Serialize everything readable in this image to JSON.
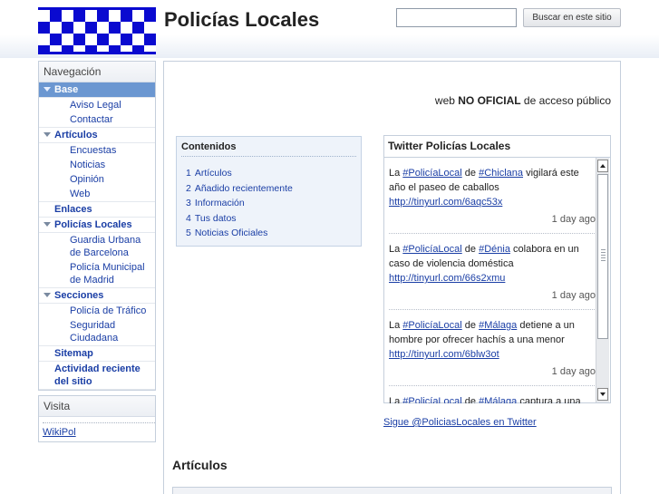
{
  "header": {
    "site_title": "Policías Locales",
    "search_placeholder": "",
    "search_button": "Buscar en este sitio"
  },
  "sidebar": {
    "nav_title": "Navegación",
    "sections": [
      {
        "label": "Base",
        "children": [
          "Aviso Legal",
          "Contactar"
        ]
      },
      {
        "label": "Artículos",
        "children": [
          "Encuestas",
          "Noticias",
          "Opinión",
          "Web"
        ]
      },
      {
        "label": "Enlaces",
        "children": []
      },
      {
        "label": "Policías Locales",
        "children": [
          "Guardia Urbana de Barcelona",
          "Policía Municipal de Madrid"
        ]
      },
      {
        "label": "Secciones",
        "children": [
          "Policía de Tráfico",
          "Seguridad Ciudadana"
        ]
      },
      {
        "label": "Sitemap",
        "children": []
      },
      {
        "label": "Actividad reciente del sitio",
        "children": []
      }
    ],
    "visit_title": "Visita",
    "visit_link": "WikiPol"
  },
  "main": {
    "tagline_prefix": "web ",
    "tagline_bold": "NO OFICIAL",
    "tagline_suffix": " de acceso público",
    "toc": {
      "title": "Contenidos",
      "items": [
        {
          "num": "1",
          "label": "Artículos"
        },
        {
          "num": "2",
          "label": "Añadido recientemente"
        },
        {
          "num": "3",
          "label": "Información"
        },
        {
          "num": "4",
          "label": "Tus datos"
        },
        {
          "num": "5",
          "label": "Noticias Oficiales"
        }
      ]
    },
    "twitter": {
      "title": "Twitter Policías Locales",
      "tweets": [
        {
          "pre": "La ",
          "tag1": "#PolicíaLocal",
          "mid": " de ",
          "tag2": "#Chiclana",
          "text": " vigilará este año el paseo de caballos",
          "url": "http://tinyurl.com/6aqc53x",
          "ago": "1 day ago"
        },
        {
          "pre": "La ",
          "tag1": "#PolicíaLocal",
          "mid": " de ",
          "tag2": "#Dénia",
          "text": " colabora en un caso de violencia doméstica",
          "url": "http://tinyurl.com/66s2xmu",
          "ago": "1 day ago"
        },
        {
          "pre": "La ",
          "tag1": "#PolicíaLocal",
          "mid": " de ",
          "tag2": "#Málaga",
          "text": " detiene a un hombre por ofrecer hachís a una menor",
          "url": "http://tinyurl.com/6blw3ot",
          "ago": "1 day ago"
        },
        {
          "pre": "La ",
          "tag1": "#PolicíaLocal",
          "mid": " de ",
          "tag2": "#Málaga",
          "text": " captura a una culebra bastarda de un metro y medio",
          "url": "",
          "ago": ""
        }
      ],
      "follow_link": "Sigue @PoliciasLocales en Twitter"
    },
    "articles_heading": "Artículos"
  },
  "colors": {
    "logo_blue": "#0a0ad0",
    "link": "#1a3ea5",
    "nav_selected_bg": "#6b97d1",
    "toc_bg": "#eef3fa"
  }
}
